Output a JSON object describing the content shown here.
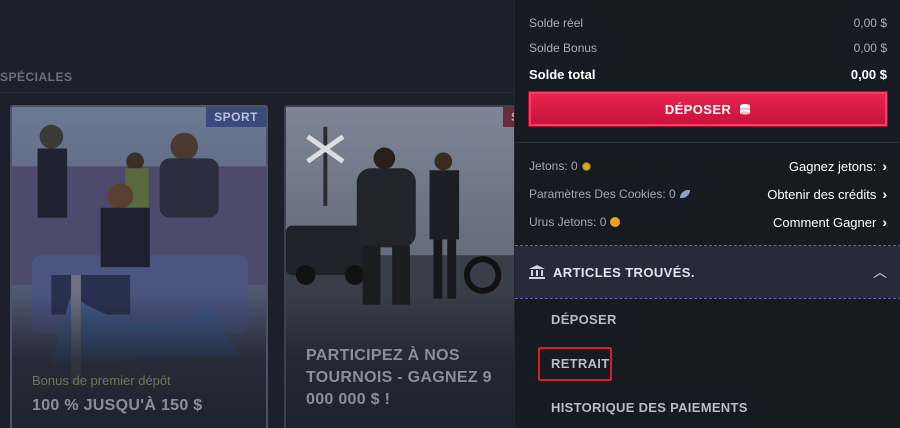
{
  "background": {
    "section_label": "SPÉCIALES",
    "cards": [
      {
        "badge": "SPORT",
        "subtitle": "Bonus de premier dépôt",
        "title": "100 % JUSQU'À 150 $"
      },
      {
        "badge": "SP",
        "subtitle": "",
        "title": "PARTICIPEZ À NOS TOURNOIS - GAGNEZ 9 000 000 $ !"
      }
    ]
  },
  "balance": {
    "real_label": "Solde réel",
    "real_value": "0,00 $",
    "bonus_label": "Solde Bonus",
    "bonus_value": "0,00 $",
    "total_label": "Solde total",
    "total_value": "0,00 $"
  },
  "deposit_button": {
    "label": "DÉPOSER",
    "icon": "coins-icon"
  },
  "tokens": [
    {
      "label": "Jetons: 0",
      "icon": "coin-icon",
      "link": "Gagnez jetons:"
    },
    {
      "label": "Paramètres Des Cookies: 0",
      "icon": "leaf-icon",
      "link": "Obtenir des crédits"
    },
    {
      "label": "Urus Jetons: 0",
      "icon": "smile-icon",
      "link": "Comment Gagner"
    }
  ],
  "accordion": {
    "title": "ARTICLES TROUVÉS.",
    "icon": "bank-icon",
    "items": [
      {
        "label": "DÉPOSER"
      },
      {
        "label": "RETRAIT"
      },
      {
        "label": "HISTORIQUE DES PAIEMENTS"
      }
    ]
  },
  "colors": {
    "accent": "#e0193f",
    "highlight": "#e0192f",
    "panel_bg": "#161a21"
  }
}
